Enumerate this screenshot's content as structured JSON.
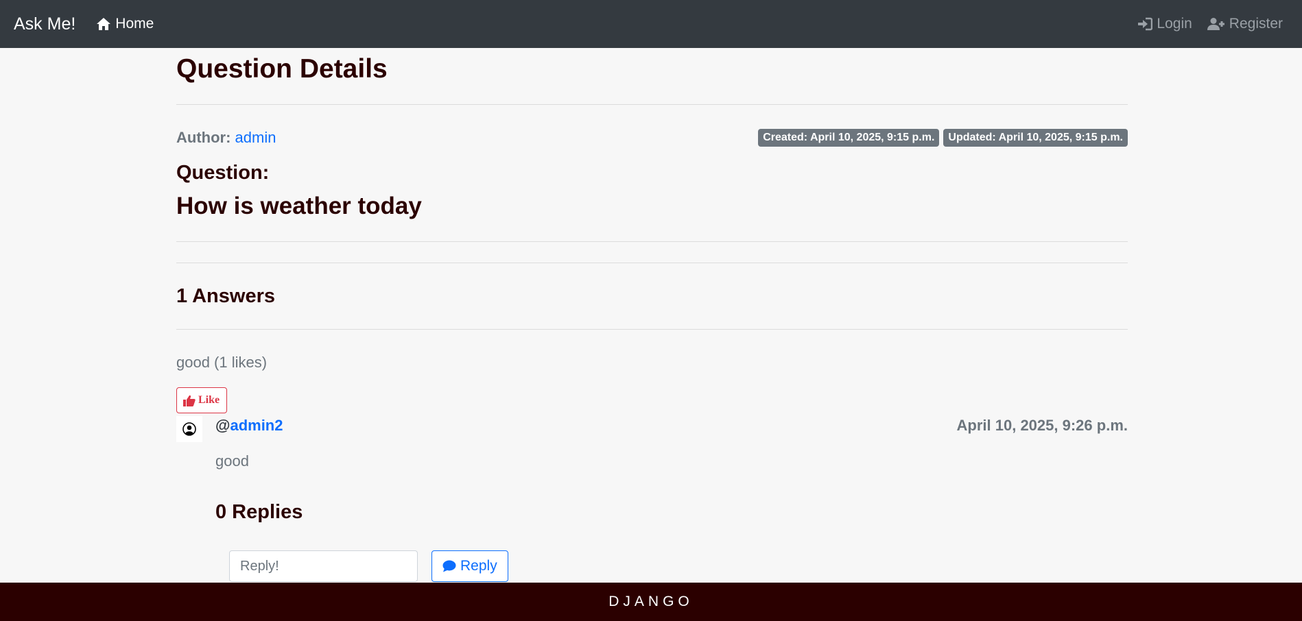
{
  "navbar": {
    "brand": "Ask Me!",
    "home_label": "Home",
    "login_label": "Login",
    "register_label": "Register"
  },
  "page": {
    "title": "Question Details",
    "author_label": "Author:",
    "author_name": "admin",
    "created_badge": "Created: April 10, 2025, 9:15 p.m.",
    "updated_badge": "Updated: April 10, 2025, 9:15 p.m.",
    "question_label": "Question:",
    "question_text": "How is weather today"
  },
  "answers": {
    "title": "1 Answers",
    "items": [
      {
        "summary": "good (1 likes)",
        "like_label": "Like",
        "user_prefix": "@",
        "user": "admin2",
        "date": "April 10, 2025, 9:26 p.m.",
        "text": "good",
        "replies_title": "0 Replies",
        "reply_placeholder": "Reply!",
        "reply_button": "Reply"
      }
    ]
  },
  "footer": {
    "text": "DJANGO"
  },
  "colors": {
    "navbar_bg": "#343a40",
    "footer_bg": "#2b0000",
    "link": "#0d6efd",
    "like": "#dc3545",
    "heading": "#2b0000"
  }
}
